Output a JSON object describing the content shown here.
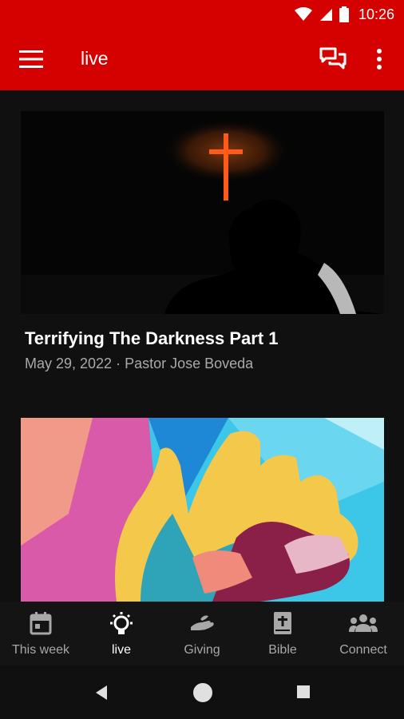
{
  "status_bar": {
    "time": "10:26"
  },
  "app_bar": {
    "title": "live"
  },
  "cards": [
    {
      "title": "Terrifying The Darkness Part 1",
      "meta": "May 29, 2022 · Pastor Jose Boveda"
    }
  ],
  "bottom_nav": {
    "items": [
      {
        "label": "This week",
        "icon": "calendar-icon",
        "active": false
      },
      {
        "label": "live",
        "icon": "lightbulb-icon",
        "active": true
      },
      {
        "label": "Giving",
        "icon": "giving-hand-icon",
        "active": false
      },
      {
        "label": "Bible",
        "icon": "bible-icon",
        "active": false
      },
      {
        "label": "Connect",
        "icon": "group-icon",
        "active": false
      }
    ]
  },
  "colors": {
    "accent": "#d50000",
    "background": "#101010",
    "muted_text": "#a9a9a9"
  }
}
